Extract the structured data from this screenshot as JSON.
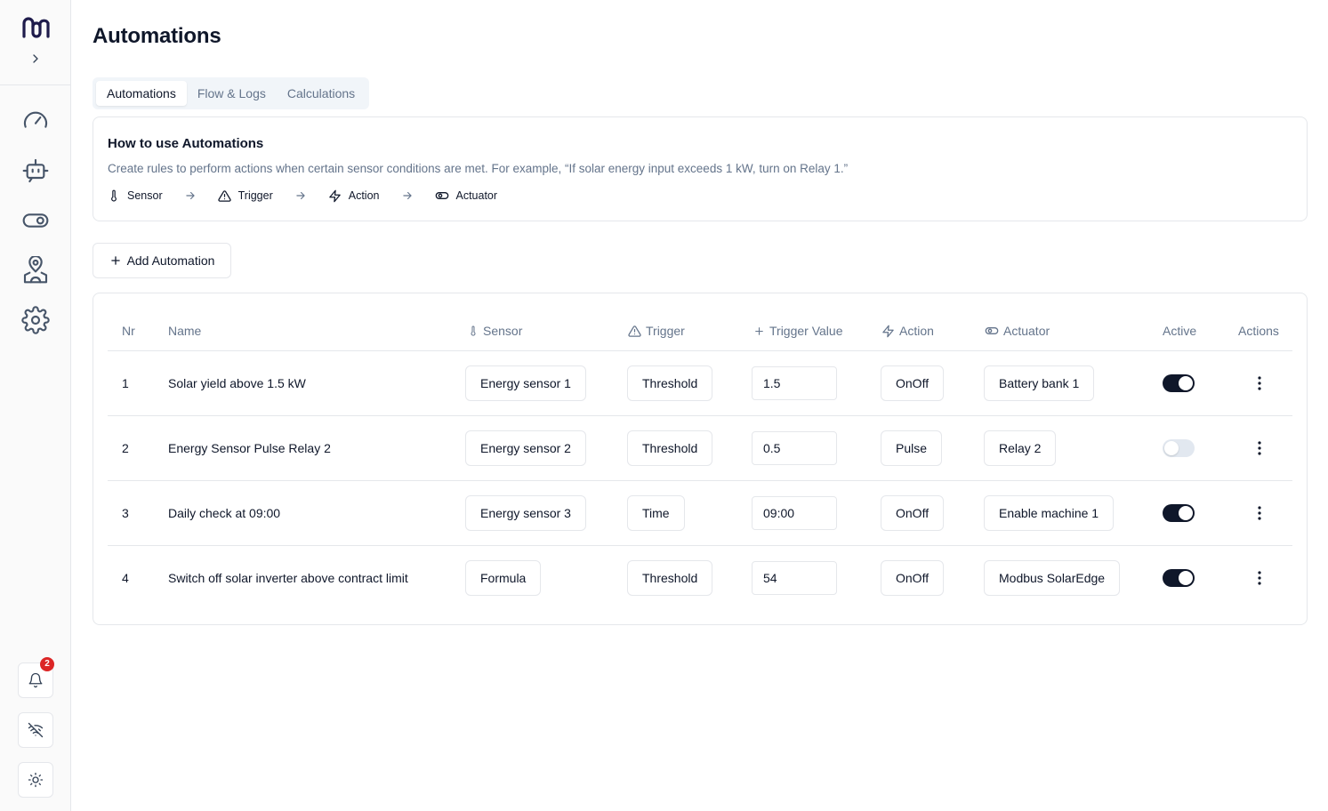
{
  "page": {
    "title": "Automations"
  },
  "sidebar": {
    "logo_icon": "brand-logo-icon",
    "expand_icon": "chevron-right-icon",
    "nav": [
      {
        "name": "dashboard",
        "icon": "gauge-icon"
      },
      {
        "name": "automations",
        "icon": "robot-icon"
      },
      {
        "name": "actuators",
        "icon": "toggle-icon"
      },
      {
        "name": "sites",
        "icon": "map-pin-user-icon"
      },
      {
        "name": "settings",
        "icon": "gear-icon"
      }
    ],
    "notifications": {
      "icon": "bell-icon",
      "count": "2"
    },
    "connection": {
      "icon": "wifi-off-icon"
    },
    "theme": {
      "icon": "sun-icon"
    }
  },
  "tabs": [
    {
      "label": "Automations",
      "active": true
    },
    {
      "label": "Flow & Logs",
      "active": false
    },
    {
      "label": "Calculations",
      "active": false
    }
  ],
  "info": {
    "title": "How to use Automations",
    "description": "Create rules to perform actions when certain sensor conditions are met. For example, “If solar energy input exceeds 1 kW, turn on Relay 1.”",
    "flow": [
      {
        "label": "Sensor",
        "icon": "thermometer-icon"
      },
      {
        "label": "Trigger",
        "icon": "warning-triangle-icon"
      },
      {
        "label": "Action",
        "icon": "lightning-icon"
      },
      {
        "label": "Actuator",
        "icon": "toggle-icon"
      }
    ]
  },
  "add_button": {
    "label": "Add Automation",
    "icon": "plus-icon"
  },
  "table": {
    "columns": {
      "nr": "Nr",
      "name": "Name",
      "sensor": "Sensor",
      "trigger": "Trigger",
      "trigger_value": "Trigger Value",
      "action": "Action",
      "actuator": "Actuator",
      "active": "Active",
      "actions": "Actions"
    },
    "rows": [
      {
        "nr": "1",
        "name": "Solar yield above 1.5 kW",
        "sensor": "Energy sensor 1",
        "trigger": "Threshold",
        "trigger_value": "1.5",
        "action": "OnOff",
        "actuator": "Battery bank 1",
        "active": true
      },
      {
        "nr": "2",
        "name": "Energy Sensor Pulse Relay 2",
        "sensor": "Energy sensor 2",
        "trigger": "Threshold",
        "trigger_value": "0.5",
        "action": "Pulse",
        "actuator": "Relay 2",
        "active": false
      },
      {
        "nr": "3",
        "name": "Daily check at 09:00",
        "sensor": "Energy sensor 3",
        "trigger": "Time",
        "trigger_value": "09:00",
        "action": "OnOff",
        "actuator": "Enable machine 1",
        "active": true
      },
      {
        "nr": "4",
        "name": "Switch off solar inverter above contract limit",
        "sensor": "Formula",
        "trigger": "Threshold",
        "trigger_value": "54",
        "action": "OnOff",
        "actuator": "Modbus SolarEdge",
        "active": true
      }
    ]
  },
  "colors": {
    "primary": "#0f172a",
    "muted": "#64748b",
    "border": "#e5e7eb",
    "badge": "#dc2626",
    "logo": "#1e1b4b"
  }
}
